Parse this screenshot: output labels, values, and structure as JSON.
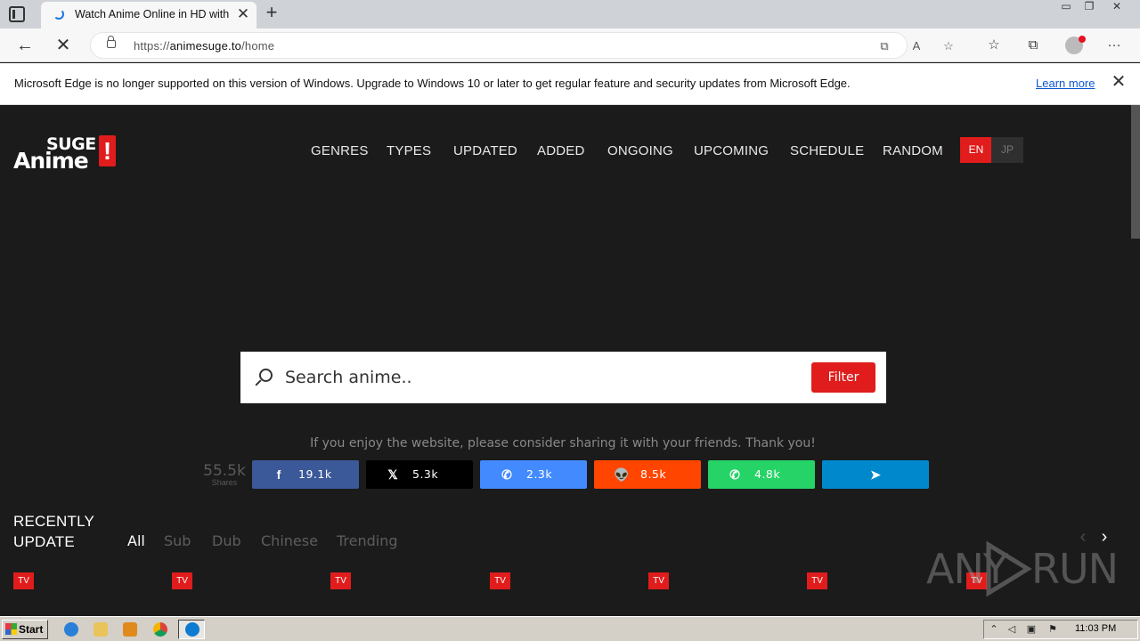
{
  "browser": {
    "tab_title": "Watch Anime Online in HD with",
    "url_protocol": "https://",
    "url_host": "animesuge.to",
    "url_path": "/home",
    "info_message": "Microsoft Edge is no longer supported on this version of Windows. Upgrade to Windows 10 or later to get regular feature and security updates from Microsoft Edge.",
    "info_link": "Learn more"
  },
  "site": {
    "logo_top": "SUGE",
    "logo_bottom": "Anime",
    "logo_mark": "!",
    "nav": [
      "GENRES",
      "TYPES",
      "UPDATED",
      "ADDED",
      "ONGOING",
      "UPCOMING",
      "SCHEDULE",
      "RANDOM"
    ],
    "lang_en": "EN",
    "lang_jp": "JP",
    "accent_color": "#e01c1c"
  },
  "search": {
    "placeholder": "Search anime..",
    "filter_label": "Filter"
  },
  "share": {
    "message": "If you enjoy the website, please consider sharing it with your friends. Thank you!",
    "total": "55.5k",
    "total_label": "Shares",
    "buttons": [
      {
        "network": "facebook",
        "icon": "f",
        "count": "19.1k",
        "color": "#3b5998"
      },
      {
        "network": "x",
        "icon": "𝕏",
        "count": "5.3k",
        "color": "#000000"
      },
      {
        "network": "messenger",
        "icon": "✆",
        "count": "2.3k",
        "color": "#448aff"
      },
      {
        "network": "reddit",
        "icon": "👽",
        "count": "8.5k",
        "color": "#ff4500"
      },
      {
        "network": "whatsapp",
        "icon": "✆",
        "count": "4.8k",
        "color": "#25d366"
      },
      {
        "network": "telegram",
        "icon": "➤",
        "count": "",
        "color": "#0088cc"
      }
    ]
  },
  "recent": {
    "title_line1": "RECENTLY",
    "title_line2": "UPDATE",
    "tabs": [
      "All",
      "Sub",
      "Dub",
      "Chinese",
      "Trending"
    ],
    "badge": "TV"
  },
  "watermark": {
    "left": "ANY",
    "right": "RUN"
  },
  "taskbar": {
    "start_label": "Start",
    "clock": "11:03 PM"
  }
}
